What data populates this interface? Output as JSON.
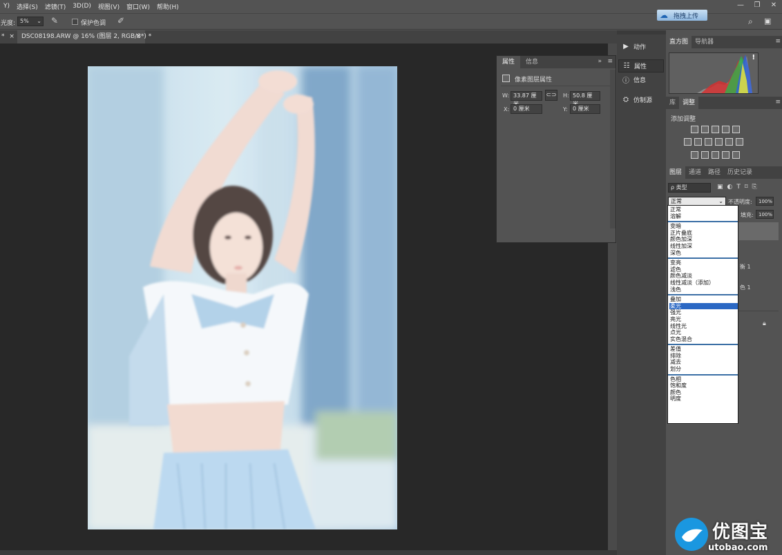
{
  "menu": [
    "Y)",
    "选择(S)",
    "滤镜(T)",
    "3D(D)",
    "视图(V)",
    "窗口(W)",
    "帮助(H)"
  ],
  "window_controls": [
    "—",
    "❐",
    "✕"
  ],
  "cloud_upload": {
    "label": "拖拽上传",
    "icon": "cloud-icon"
  },
  "options": {
    "exposure_label": "光度:",
    "exposure_value": "5%",
    "protect_tones_label": "保护色调"
  },
  "tabs": {
    "prev_tab_suffix": "*",
    "prev_tab_close": "×",
    "document_title": "DSC08198.ARW @ 16% (图层 2, RGB/8*) *",
    "document_close": "×"
  },
  "properties_panel": {
    "tabs": [
      "属性",
      "信息"
    ],
    "title": "像素图层属性",
    "w_label": "W:",
    "w_value": "33.87 厘米",
    "h_label": "H:",
    "h_value": "50.8 厘米",
    "x_label": "X:",
    "x_value": "0 厘米",
    "y_label": "Y:",
    "y_value": "0 厘米"
  },
  "dock": {
    "items": [
      {
        "label": "动作",
        "icon": "play-icon"
      },
      {
        "label": "属性",
        "icon": "properties-icon"
      },
      {
        "label": "信息",
        "icon": "info-icon"
      },
      {
        "label": "仿制源",
        "icon": "clone-source-icon"
      }
    ]
  },
  "histogram_panel": {
    "tabs": [
      "直方图",
      "导航器"
    ],
    "warning": "!"
  },
  "adjust_panel": {
    "tabs": [
      "库",
      "调整"
    ],
    "add_label": "添加调整"
  },
  "layers_panel": {
    "tabs": [
      "图层",
      "通道",
      "路径",
      "历史记录"
    ],
    "filter_label": "ρ 类型",
    "blend_mode": "正常",
    "opacity_label": "不透明度:",
    "opacity_value": "100%",
    "fill_label": "填充:",
    "fill_value": "100%",
    "row_partials": [
      "衡 1",
      "色 1"
    ]
  },
  "blend_modes": [
    [
      "正常",
      "溶解"
    ],
    [
      "变暗",
      "正片叠底",
      "颜色加深",
      "线性加深",
      "深色"
    ],
    [
      "变亮",
      "滤色",
      "颜色减淡",
      "线性减淡（添加）",
      "浅色"
    ],
    [
      "叠加",
      "柔光",
      "强光",
      "亮光",
      "线性光",
      "点光",
      "实色混合"
    ],
    [
      "差值",
      "排除",
      "减去",
      "划分"
    ],
    [
      "色相",
      "饱和度",
      "颜色",
      "明度"
    ]
  ],
  "selected_blend_mode": "柔光",
  "watermark": {
    "brand": "优图宝",
    "url": "utobao.com"
  }
}
